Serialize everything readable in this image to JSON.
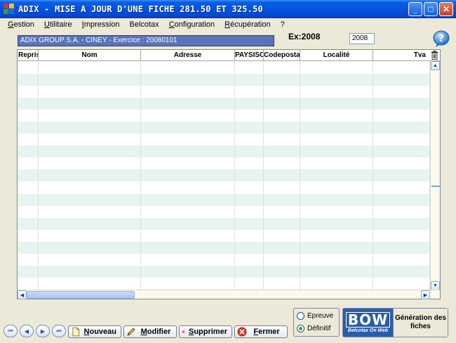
{
  "window": {
    "title": "ADIX - MISE A JOUR D'UNE FICHE 281.50 ET 325.50",
    "min_glyph": "_",
    "max_glyph": "□",
    "close_glyph": "✕"
  },
  "menu": [
    {
      "u": "G",
      "rest": "estion"
    },
    {
      "u": "U",
      "rest": "tilitaire"
    },
    {
      "u": "I",
      "rest": "mpression"
    },
    {
      "u": "",
      "rest": "Belcotax"
    },
    {
      "u": "C",
      "rest": "onfiguration"
    },
    {
      "u": "R",
      "rest": "écupération"
    },
    {
      "u": "",
      "rest": "?"
    }
  ],
  "header": {
    "company": "ADIX GROUP S.A.  - CINEY - Exercice : 20080101",
    "ex_label": "Ex:2008",
    "year_value": "2008"
  },
  "grid": {
    "columns": [
      "Repris",
      "Nom",
      "Adresse",
      "PAYSISO",
      "Codepostal",
      "Localité",
      "Tva"
    ],
    "row_count": 19
  },
  "toolbar": {
    "nav": [
      "⏮",
      "◀",
      "▶",
      "⏭"
    ],
    "buttons": {
      "nouveau": {
        "u": "N",
        "rest": "ouveau"
      },
      "modifier": {
        "u": "M",
        "rest": "odifier"
      },
      "supprimer": {
        "u": "S",
        "rest": "upprimer"
      },
      "fermer": {
        "u": "F",
        "rest": "ermer"
      }
    }
  },
  "options": {
    "epreuve": "Epreuve",
    "definitif": "Définitif",
    "selected": "definitif"
  },
  "generation": {
    "logo_main": "BOW",
    "logo_sub": "Belcotax On Web",
    "label": "Génération des fiches"
  },
  "colors": {
    "titlebar": "#0254e0",
    "company_bg": "#5b73b9",
    "row_alt": "#e7f4f1"
  }
}
